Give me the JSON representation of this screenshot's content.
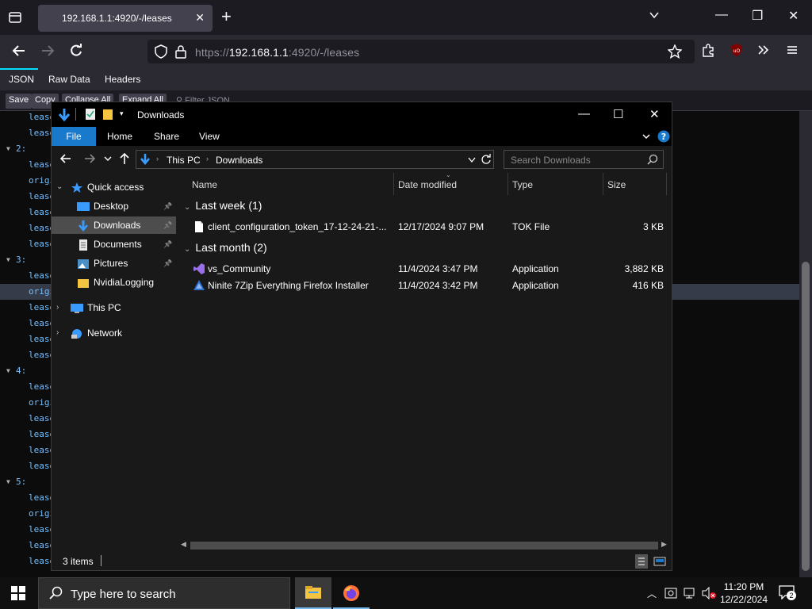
{
  "browser": {
    "tab_title": "192.168.1.1:4920/-/leases",
    "url_scheme": "https://",
    "url_host": "192.168.1.1",
    "url_rest": ":4920/-/leases"
  },
  "json_viewer": {
    "tabs": [
      "JSON",
      "Raw Data",
      "Headers"
    ],
    "toolbar": [
      "Save",
      "Copy",
      "Collapse All",
      "Expand All",
      "Filter JSON"
    ],
    "rows": [
      {
        "text": "lease",
        "indent": 1
      },
      {
        "text": "lease",
        "indent": 1
      },
      {
        "text": "2:",
        "indent": 0
      },
      {
        "text": "lease",
        "indent": 1
      },
      {
        "text": "origi",
        "indent": 1
      },
      {
        "text": "lease",
        "indent": 1
      },
      {
        "text": "lease",
        "indent": 1
      },
      {
        "text": "lease",
        "indent": 1
      },
      {
        "text": "lease",
        "indent": 1
      },
      {
        "text": "3:",
        "indent": 0
      },
      {
        "text": "lease",
        "indent": 1
      },
      {
        "text": "origi",
        "indent": 1,
        "selected": true
      },
      {
        "text": "lease",
        "indent": 1
      },
      {
        "text": "lease",
        "indent": 1
      },
      {
        "text": "lease",
        "indent": 1
      },
      {
        "text": "lease",
        "indent": 1
      },
      {
        "text": "4:",
        "indent": 0
      },
      {
        "text": "lease",
        "indent": 1
      },
      {
        "text": "origi",
        "indent": 1
      },
      {
        "text": "lease",
        "indent": 1
      },
      {
        "text": "lease",
        "indent": 1
      },
      {
        "text": "lease",
        "indent": 1
      },
      {
        "text": "lease",
        "indent": 1
      },
      {
        "text": "5:",
        "indent": 0
      },
      {
        "text": "lease",
        "indent": 1
      },
      {
        "text": "origi",
        "indent": 1
      },
      {
        "text": "lease",
        "indent": 1
      },
      {
        "text": "lease",
        "indent": 1
      },
      {
        "text": "lease",
        "indent": 1
      }
    ]
  },
  "explorer": {
    "title": "Downloads",
    "ribbon": {
      "file": "File",
      "tabs": [
        "Home",
        "Share",
        "View"
      ]
    },
    "breadcrumb": [
      "This PC",
      "Downloads"
    ],
    "search_placeholder": "Search Downloads",
    "nav": [
      {
        "label": "Quick access",
        "level": 0,
        "icon": "star-icon",
        "expandable": true,
        "expanded": true
      },
      {
        "label": "Desktop",
        "level": 1,
        "icon": "desktop-icon",
        "pinned": true
      },
      {
        "label": "Downloads",
        "level": 1,
        "icon": "download-icon",
        "pinned": true,
        "selected": true
      },
      {
        "label": "Documents",
        "level": 1,
        "icon": "documents-icon",
        "pinned": true
      },
      {
        "label": "Pictures",
        "level": 1,
        "icon": "pictures-icon",
        "pinned": true
      },
      {
        "label": "NvidiaLogging",
        "level": 1,
        "icon": "folder-icon"
      },
      {
        "label": "This PC",
        "level": 0,
        "icon": "computer-icon",
        "expandable": true
      },
      {
        "label": "Network",
        "level": 0,
        "icon": "network-icon",
        "expandable": true
      }
    ],
    "columns": [
      "Name",
      "Date modified",
      "Type",
      "Size"
    ],
    "groups": [
      {
        "label": "Last week (1)",
        "files": [
          {
            "name": "client_configuration_token_17-12-24-21-...",
            "date": "12/17/2024 9:07 PM",
            "type": "TOK File",
            "size": "3 KB",
            "icon": "file-icon"
          }
        ]
      },
      {
        "label": "Last month (2)",
        "files": [
          {
            "name": "vs_Community",
            "date": "11/4/2024 3:47 PM",
            "type": "Application",
            "size": "3,882 KB",
            "icon": "visual-studio-icon"
          },
          {
            "name": "Ninite 7Zip Everything Firefox Installer",
            "date": "11/4/2024 3:42 PM",
            "type": "Application",
            "size": "416 KB",
            "icon": "ninite-icon"
          }
        ]
      }
    ],
    "status": "3 items"
  },
  "taskbar": {
    "search_placeholder": "Type here to search",
    "time": "11:20 PM",
    "date": "12/22/2024",
    "notification_count": "2"
  },
  "colors": {
    "accent": "#1979ca",
    "folder": "#f5c542",
    "firefox": "#ff7139"
  }
}
